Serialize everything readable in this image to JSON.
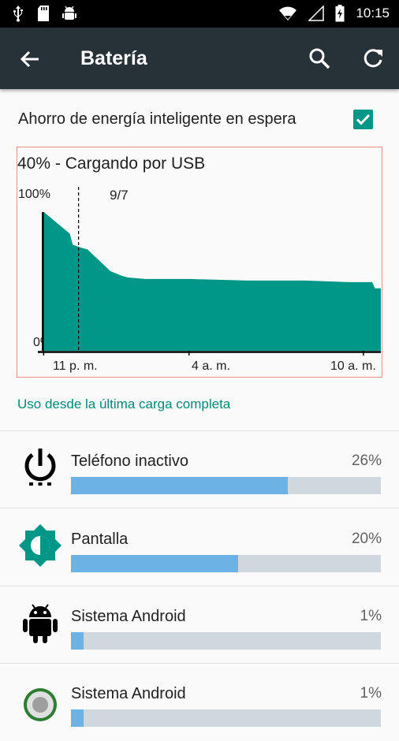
{
  "status_bar": {
    "time": "10:15",
    "icons": [
      "usb-icon",
      "sd-card-icon",
      "android-debug-icon",
      "wifi-icon",
      "signal-icon",
      "battery-charging-icon"
    ]
  },
  "app_bar": {
    "title": "Batería",
    "icons": [
      "back-arrow-icon",
      "search-icon",
      "refresh-icon"
    ]
  },
  "preference": {
    "label": "Ahorro de energía inteligente en espera",
    "checked": true
  },
  "chart_data": {
    "type": "area",
    "title": "40% - Cargando por USB",
    "y_tick_labels": [
      "100%",
      "0%"
    ],
    "ylim": [
      0,
      100
    ],
    "x_tick_labels": [
      "11 p. m.",
      "4 a. m.",
      "10 a. m."
    ],
    "x_hours": [
      0,
      5,
      11
    ],
    "x_range_hours": [
      -0.2,
      11.6
    ],
    "marker": {
      "label": "9/7",
      "x_hour": 1.2
    },
    "series": [
      {
        "x_hours": [
          0,
          0.45,
          0.9,
          1.0,
          1.3,
          1.5,
          1.9,
          2.3,
          2.7,
          2.9,
          3.5,
          5.0,
          7.0,
          9.0,
          10.5,
          11.2,
          11.3,
          11.4,
          11.6
        ],
        "values": [
          89,
          82,
          75,
          68,
          66,
          65,
          58,
          51,
          48,
          47,
          46,
          46,
          45,
          45,
          44,
          44,
          44,
          40,
          40
        ]
      }
    ],
    "fill_color": "#009688"
  },
  "section_link": "Uso desde la última carga completa",
  "usage": [
    {
      "name": "Teléfono inactivo",
      "percent_label": "26%",
      "fraction": 0.7,
      "icon": "power-standby-icon"
    },
    {
      "name": "Pantalla",
      "percent_label": "20%",
      "fraction": 0.54,
      "icon": "brightness-icon"
    },
    {
      "name": "Sistema Android",
      "percent_label": "1%",
      "fraction": 0.04,
      "icon": "android-robot-icon"
    },
    {
      "name": "Sistema Android",
      "percent_label": "1%",
      "fraction": 0.04,
      "icon": "android-system-icon"
    }
  ],
  "colors": {
    "accent": "#009688",
    "bar_fill": "#6cb2e4",
    "bar_track": "#cfd8dc",
    "app_bar": "#263238"
  }
}
